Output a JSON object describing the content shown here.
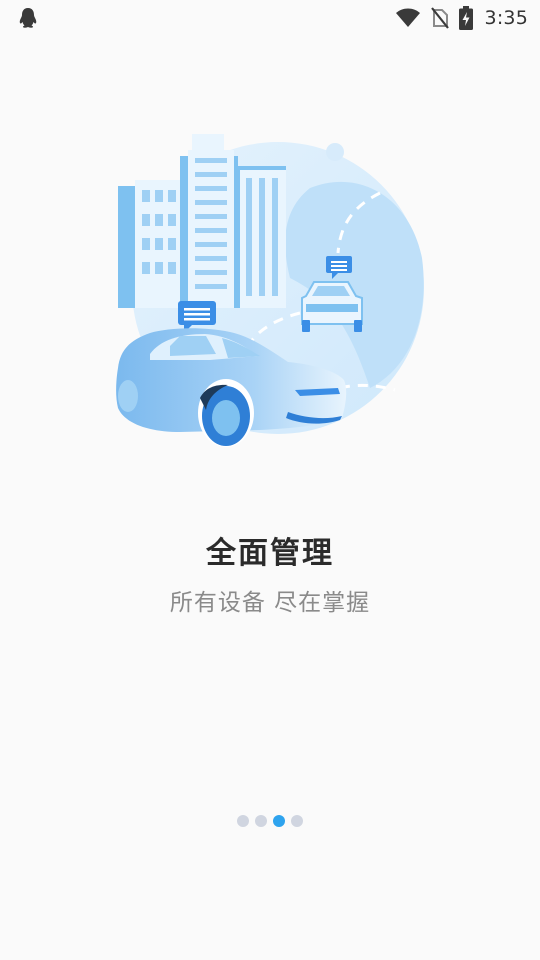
{
  "status_bar": {
    "time": "3:35",
    "icons": [
      "qq-icon",
      "wifi-icon",
      "no-sim-icon",
      "battery-charging-icon"
    ]
  },
  "onboarding": {
    "title": "全面管理",
    "subtitle": "所有设备 尽在掌握",
    "illustration": "city-car-illustration",
    "page_count": 4,
    "current_page": 3
  },
  "colors": {
    "background": "#fafafa",
    "accent": "#2ea3ee",
    "dot_inactive": "#d0d5e0",
    "title": "#2b2b2b",
    "subtitle": "#8a8a8a"
  }
}
